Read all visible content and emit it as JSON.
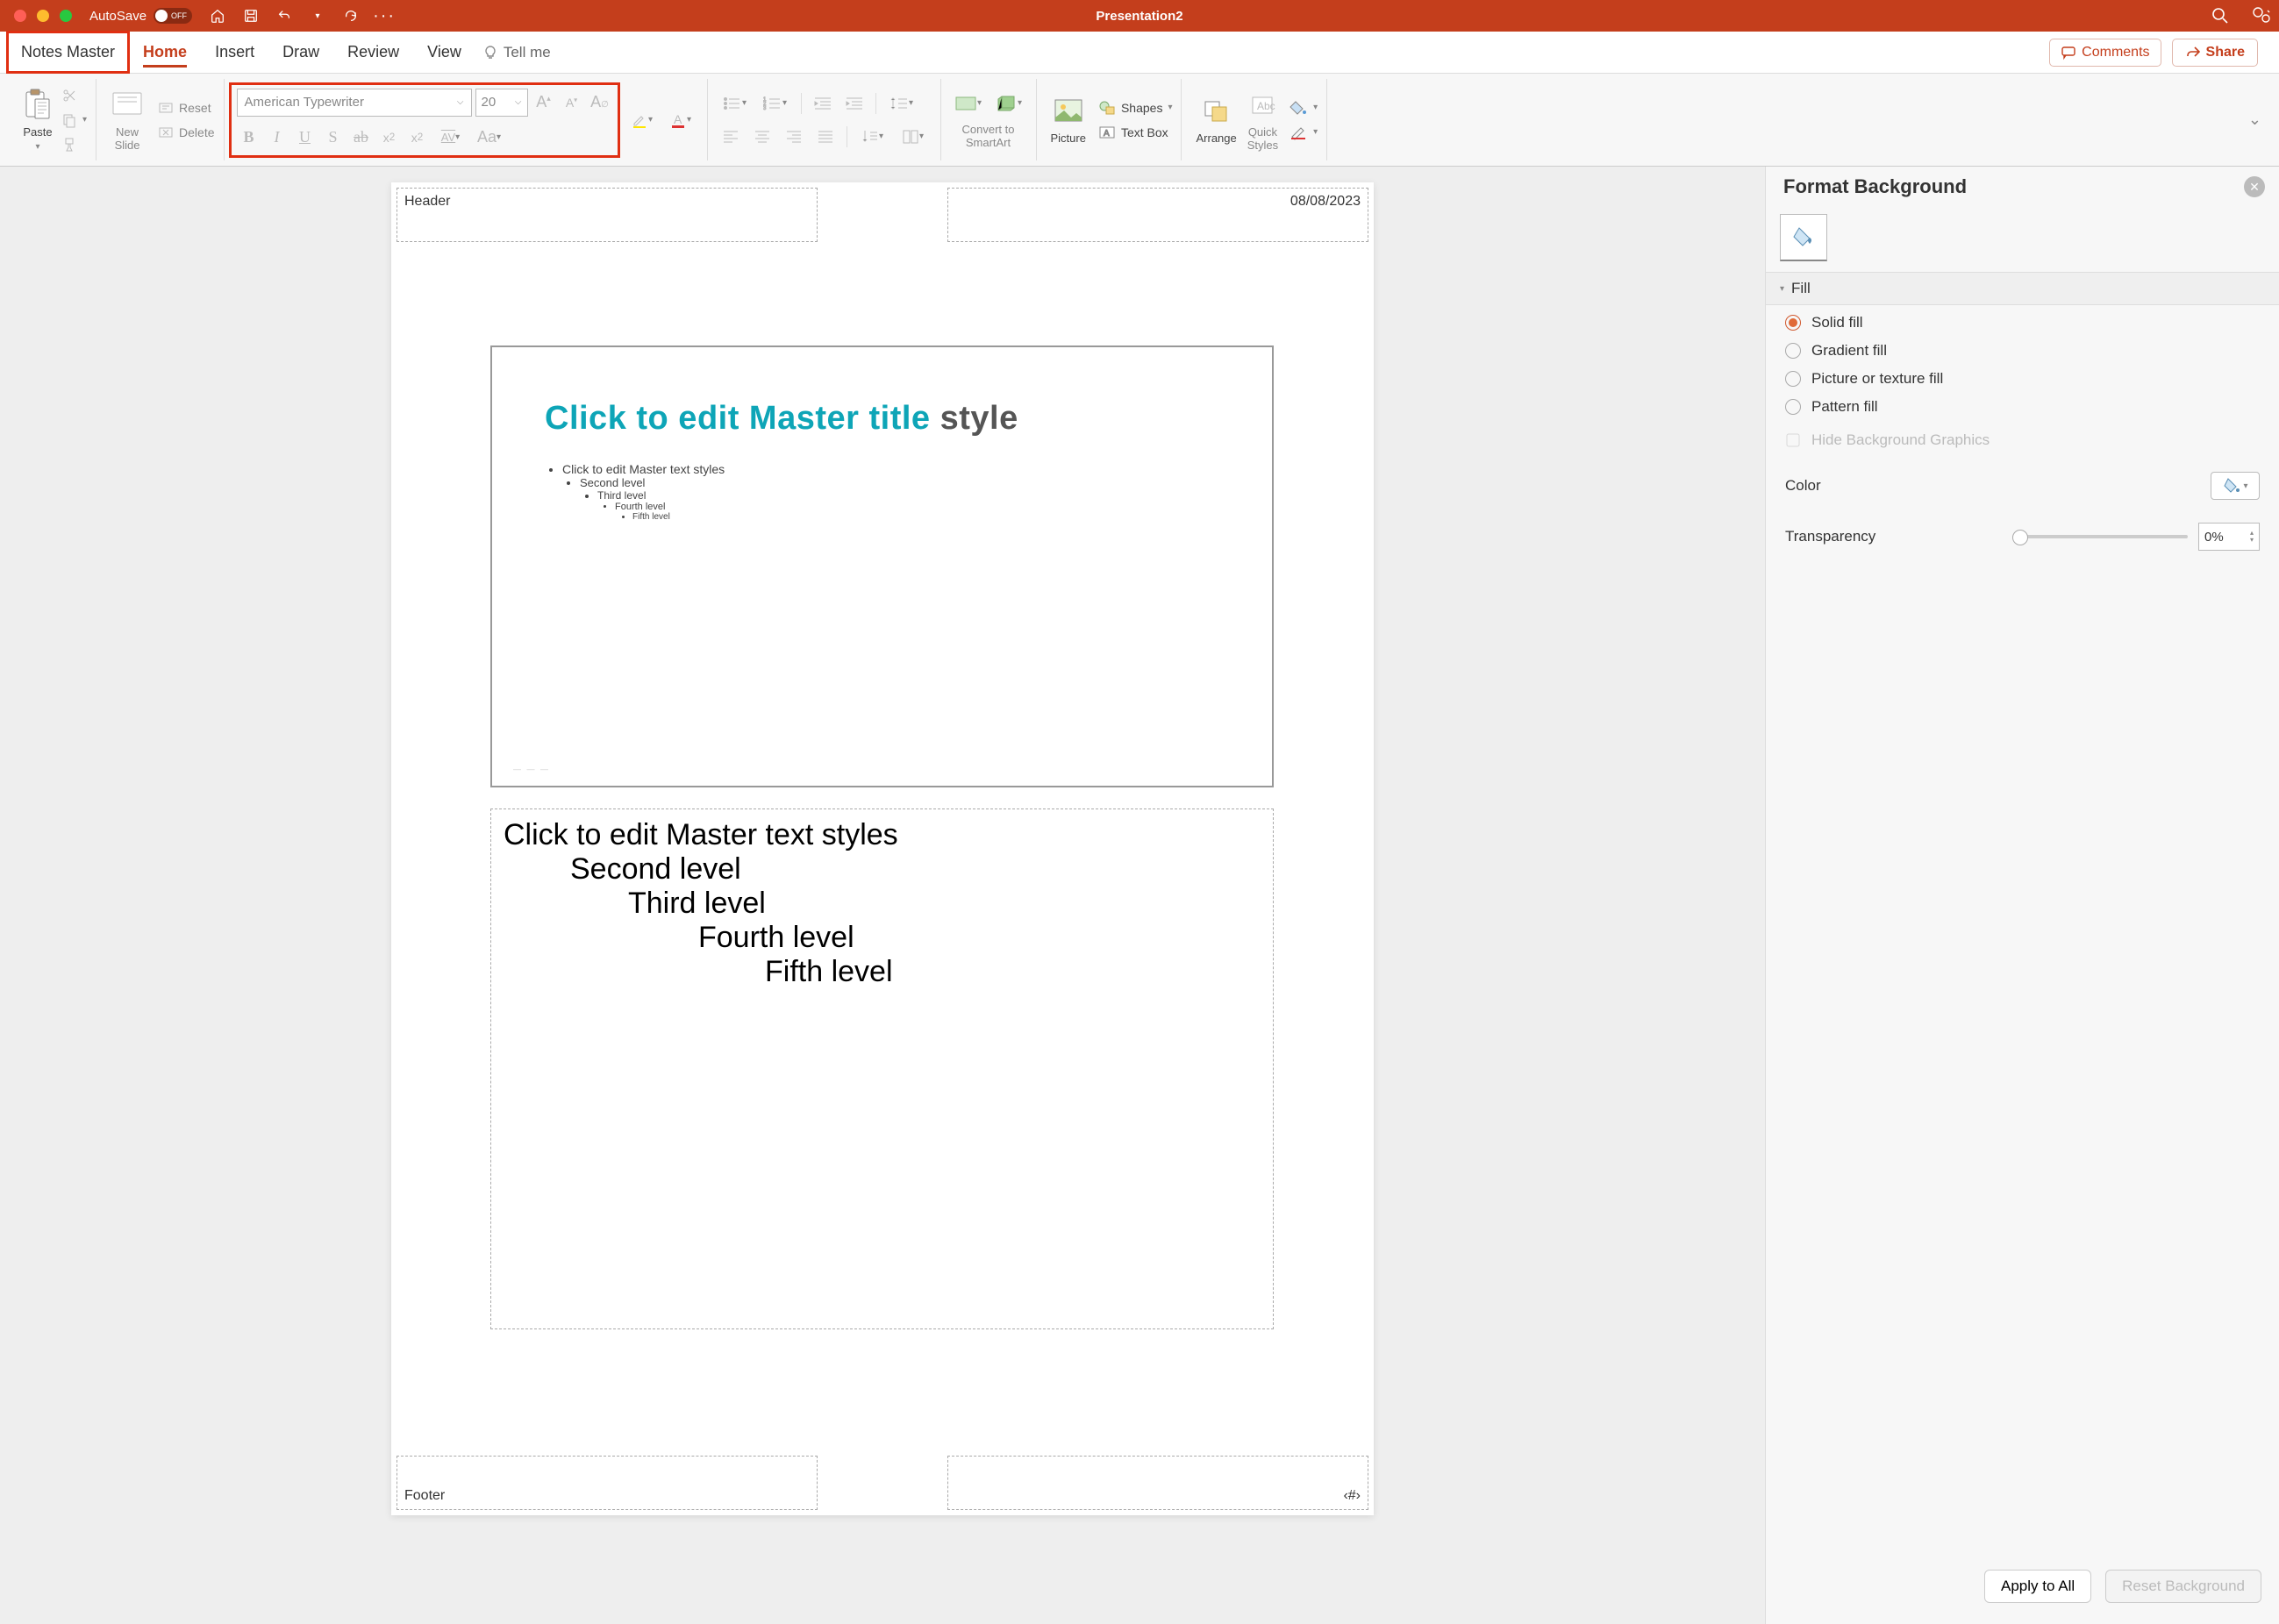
{
  "titlebar": {
    "autosave_label": "AutoSave",
    "autosave_state": "OFF",
    "title": "Presentation2"
  },
  "tabs": {
    "notes_master": "Notes Master",
    "home": "Home",
    "insert": "Insert",
    "draw": "Draw",
    "review": "Review",
    "view": "View",
    "tell_me": "Tell me",
    "comments": "Comments",
    "share": "Share"
  },
  "ribbon": {
    "paste": "Paste",
    "new_slide": "New\nSlide",
    "reset": "Reset",
    "delete": "Delete",
    "font_name": "American Typewriter",
    "font_size": "20",
    "convert_to_smartart": "Convert to\nSmartArt",
    "picture": "Picture",
    "shapes": "Shapes",
    "text_box": "Text Box",
    "arrange": "Arrange",
    "quick_styles": "Quick\nStyles"
  },
  "page": {
    "header": "Header",
    "date": "08/08/2023",
    "footer": "Footer",
    "page_num": "‹#›",
    "slide_title_a": "Click to edit Master title ",
    "slide_title_b": "style",
    "slide_bullets": {
      "l1": "Click to edit Master text styles",
      "l2": "Second level",
      "l3": "Third level",
      "l4": "Fourth level",
      "l5": "Fifth level"
    },
    "notes": {
      "l1": "Click to edit Master text styles",
      "l2": "Second level",
      "l3": "Third level",
      "l4": "Fourth level",
      "l5": "Fifth level"
    }
  },
  "sidepanel": {
    "title": "Format Background",
    "fill_section": "Fill",
    "solid_fill": "Solid fill",
    "gradient_fill": "Gradient fill",
    "picture_fill": "Picture or texture fill",
    "pattern_fill": "Pattern fill",
    "hide_graphics": "Hide Background Graphics",
    "color_label": "Color",
    "transparency_label": "Transparency",
    "transparency_value": "0%",
    "apply_all": "Apply to All",
    "reset_bg": "Reset Background"
  }
}
